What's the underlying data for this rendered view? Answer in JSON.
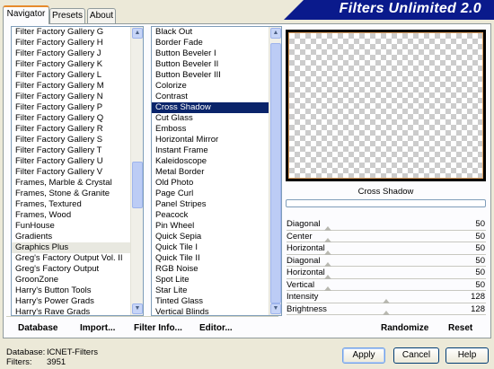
{
  "title": "Filters Unlimited 2.0",
  "tabs": [
    "Navigator",
    "Presets",
    "About"
  ],
  "categories": [
    "Filter Factory Gallery G",
    "Filter Factory Gallery H",
    "Filter Factory Gallery J",
    "Filter Factory Gallery K",
    "Filter Factory Gallery L",
    "Filter Factory Gallery M",
    "Filter Factory Gallery N",
    "Filter Factory Gallery P",
    "Filter Factory Gallery Q",
    "Filter Factory Gallery R",
    "Filter Factory Gallery S",
    "Filter Factory Gallery T",
    "Filter Factory Gallery U",
    "Filter Factory Gallery V",
    "Frames, Marble & Crystal",
    "Frames, Stone & Granite",
    "Frames, Textured",
    "Frames, Wood",
    "FunHouse",
    "Gradients",
    "Graphics Plus",
    "Greg's Factory Output Vol. II",
    "Greg's Factory Output",
    "GroonZone",
    "Harry's Button Tools",
    "Harry's Power Grads",
    "Harry's Rave Grads"
  ],
  "highlighted_category": "Graphics Plus",
  "filters": [
    "Black Out",
    "Border Fade",
    "Button Beveler I",
    "Button Beveler II",
    "Button Beveler III",
    "Colorize",
    "Contrast",
    "Cross Shadow",
    "Cut Glass",
    "Emboss",
    "Horizontal Mirror",
    "Instant Frame",
    "Kaleidoscope",
    "Metal Border",
    "Old Photo",
    "Page Curl",
    "Panel Stripes",
    "Peacock",
    "Pin Wheel",
    "Quick Sepia",
    "Quick Tile I",
    "Quick Tile II",
    "RGB Noise",
    "Spot Lite",
    "Star Lite",
    "Tinted Glass",
    "Vertical Blinds"
  ],
  "selected_filter": "Cross Shadow",
  "preview_label": "Cross Shadow",
  "sliders": [
    {
      "label": "Diagonal",
      "value": "50"
    },
    {
      "label": "Center",
      "value": "50"
    },
    {
      "label": "Horizontal",
      "value": "50"
    },
    {
      "label": "Diagonal",
      "value": "50"
    },
    {
      "label": "Horizontal",
      "value": "50"
    },
    {
      "label": "Vertical",
      "value": "50"
    },
    {
      "label": "Intensity",
      "value": "128"
    },
    {
      "label": "Brightness",
      "value": "128"
    }
  ],
  "actions": {
    "database": "Database",
    "import": "Import...",
    "filter_info": "Filter Info...",
    "editor": "Editor...",
    "randomize": "Randomize",
    "reset": "Reset"
  },
  "footer": {
    "database_label": "Database:",
    "database_value": "ICNET-Filters",
    "filters_label": "Filters:",
    "filters_value": "3951"
  },
  "buttons": {
    "apply": "Apply",
    "cancel": "Cancel",
    "help": "Help"
  },
  "colors": {
    "banner": "#0a1a8c",
    "selection": "#0a246a",
    "tab_accent": "#e68b2c"
  }
}
